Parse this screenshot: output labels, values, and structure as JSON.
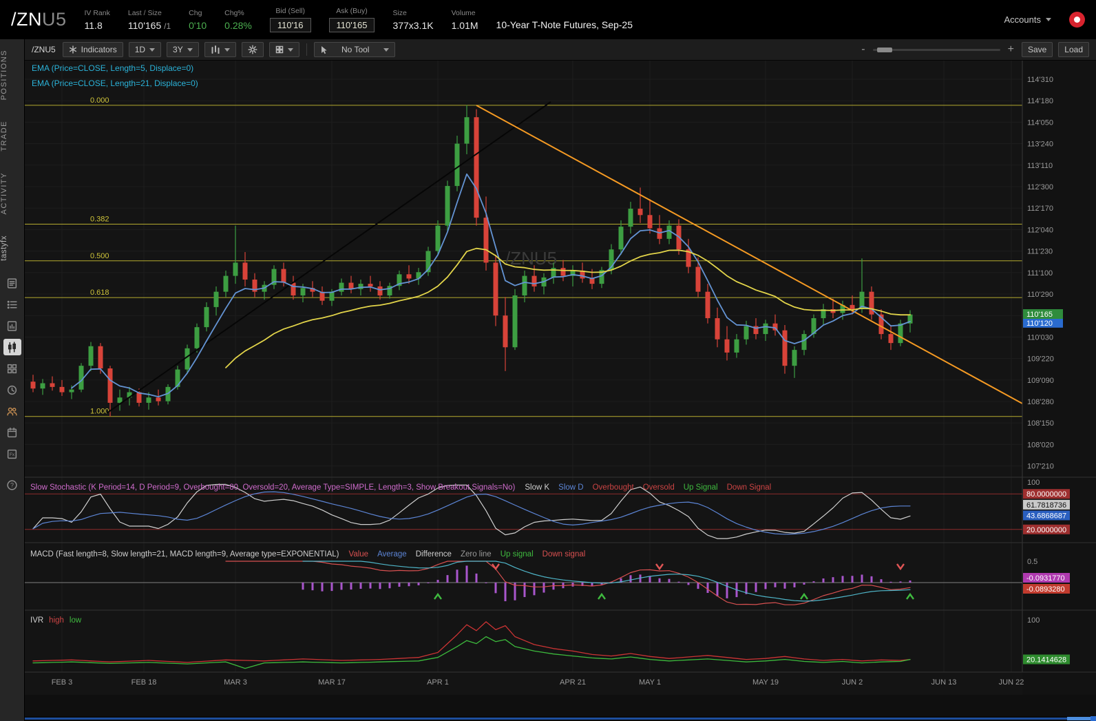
{
  "header": {
    "symbol_root": "/ZN",
    "symbol_suffix": "U5",
    "iv_rank_label": "IV Rank",
    "iv_rank_value": "11.8",
    "last_size_label": "Last / Size",
    "last_value": "110'165",
    "last_size_suffix": "/1",
    "chg_label": "Chg",
    "chg_value": "0'10",
    "chg_pct_label": "Chg%",
    "chg_pct_value": "0.28%",
    "bid_label": "Bid (Sell)",
    "bid_value": "110'16",
    "ask_label": "Ask (Buy)",
    "ask_value": "110'165",
    "size_label": "Size",
    "size_value": "377x3.1K",
    "volume_label": "Volume",
    "volume_value": "1.01M",
    "description": "10-Year T-Note Futures, Sep-25",
    "accounts_label": "Accounts",
    "up_color": "#4caf50"
  },
  "sidebar": {
    "tabs": [
      {
        "label": "POSITIONS"
      },
      {
        "label": "TRADE"
      },
      {
        "label": "ACTIVITY"
      },
      {
        "label": "tastyfx"
      }
    ],
    "icons": [
      "news-icon",
      "list-icon",
      "report-icon",
      "candle-chart-icon",
      "grid-watchlist-icon",
      "clock-icon",
      "people-icon",
      "calendar-icon",
      "functions-icon",
      "help-icon"
    ],
    "active_icon": "candle-chart-icon"
  },
  "toolbar": {
    "symbol": "/ZNU5",
    "indicators_label": "Indicators",
    "timeframe": "1D",
    "range": "3Y",
    "tool_label": "No Tool",
    "zoom_minus": "-",
    "zoom_plus": "+",
    "save_label": "Save",
    "load_label": "Load"
  },
  "chart": {
    "ema5_label": "EMA (Price=CLOSE, Length=5, Displace=0)",
    "ema21_label": "EMA (Price=CLOSE, Length=21, Displace=0)",
    "watermark": "/ZNU5",
    "ema5_color": "#6494d4",
    "ema21_color": "#e3d54a",
    "up_color": "#3d9e42",
    "down_color": "#d84339",
    "fib_color": "#b5ab2e",
    "trendline_color": "#f59a23"
  },
  "studies": {
    "stoch": {
      "title": "Slow Stochastic (K Period=14, D Period=9, Overbought=80, Oversold=20, Average Type=SIMPLE, Length=3, Show Breakout Signals=No)",
      "title_color": "#d06ccd",
      "legend": [
        {
          "text": "Slow K",
          "color": "#cfcfcf"
        },
        {
          "text": "Slow D",
          "color": "#5c85d6"
        },
        {
          "text": "Overbought",
          "color": "#cc4444"
        },
        {
          "text": "Oversold",
          "color": "#cc4444"
        },
        {
          "text": "Up Signal",
          "color": "#3fba3f"
        },
        {
          "text": "Down Signal",
          "color": "#cc4444"
        }
      ],
      "axis_top": "100",
      "tags": [
        {
          "text": "80.0000000",
          "value": 80,
          "bg": "#9e2f2f",
          "fg": "#fff"
        },
        {
          "text": "61.7818736",
          "value": 61.78,
          "bg": "#c9c9c9",
          "fg": "#111"
        },
        {
          "text": "43.6868687",
          "value": 43.69,
          "bg": "#2a5fc0",
          "fg": "#fff"
        },
        {
          "text": "20.0000000",
          "value": 20,
          "bg": "#9e2f2f",
          "fg": "#fff"
        }
      ]
    },
    "macd": {
      "title": "MACD (Fast length=8, Slow length=21, MACD length=9, Average type=EXPONENTIAL)",
      "title_color": "#cfcfcf",
      "legend": [
        {
          "text": "Value",
          "color": "#d85050"
        },
        {
          "text": "Average",
          "color": "#5c85d6"
        },
        {
          "text": "Difference",
          "color": "#cfcfcf"
        },
        {
          "text": "Zero line",
          "color": "#9a9a9a"
        },
        {
          "text": "Up signal",
          "color": "#3fba3f"
        },
        {
          "text": "Down signal",
          "color": "#d85050"
        }
      ],
      "axis_top": "0.5",
      "tags": [
        {
          "text": "-0.0931770",
          "bg": "#b03ab0",
          "fg": "#fff"
        },
        {
          "text": "-0.0893280",
          "bg": "#c23b2e",
          "fg": "#fff"
        }
      ]
    },
    "ivr": {
      "title": "IVR",
      "title_color": "#cfcfcf",
      "legend": [
        {
          "text": "high",
          "color": "#cc4444"
        },
        {
          "text": "low",
          "color": "#3fba3f"
        }
      ],
      "axis_top": "100",
      "tag": {
        "text": "20.1414628",
        "bg": "#2e8b2e",
        "fg": "#fff"
      }
    }
  },
  "chart_data": {
    "type": "candlestick",
    "symbol": "/ZNU5",
    "timeframe": "1D",
    "range": "3Y",
    "price_ticks": [
      {
        "t": "114'310",
        "i": 0
      },
      {
        "t": "114'180",
        "i": 1
      },
      {
        "t": "114'050",
        "i": 2
      },
      {
        "t": "113'240",
        "i": 3
      },
      {
        "t": "113'110",
        "i": 4
      },
      {
        "t": "112'300",
        "i": 5
      },
      {
        "t": "112'170",
        "i": 6
      },
      {
        "t": "112'040",
        "i": 7
      },
      {
        "t": "111'230",
        "i": 8
      },
      {
        "t": "111'100",
        "i": 9
      },
      {
        "t": "110'290",
        "i": 10
      },
      {
        "t": "110'030",
        "i": 12
      },
      {
        "t": "109'220",
        "i": 13
      },
      {
        "t": "109'090",
        "i": 14
      },
      {
        "t": "108'280",
        "i": 15
      },
      {
        "t": "108'150",
        "i": 16
      },
      {
        "t": "108'020",
        "i": 17
      },
      {
        "t": "107'210",
        "i": 18
      }
    ],
    "x_ticks": [
      {
        "t": "FEB 3",
        "i": 3
      },
      {
        "t": "FEB 18",
        "i": 11.5
      },
      {
        "t": "MAR 3",
        "i": 21
      },
      {
        "t": "MAR 17",
        "i": 31
      },
      {
        "t": "APR 1",
        "i": 42
      },
      {
        "t": "APR 21",
        "i": 56
      },
      {
        "t": "MAY 1",
        "i": 64
      },
      {
        "t": "MAY 19",
        "i": 76
      },
      {
        "t": "JUN 2",
        "i": 85
      },
      {
        "t": "JUN 13",
        "i": 94.5
      },
      {
        "t": "JUN 22",
        "i": 101.5
      }
    ],
    "fib_levels": [
      {
        "label": "0.000",
        "price": 114.476
      },
      {
        "label": "0.382",
        "price": 112.228
      },
      {
        "label": "0.500",
        "price": 111.534
      },
      {
        "label": "0.618",
        "price": 110.84
      },
      {
        "label": "1.000",
        "price": 108.592
      }
    ],
    "last_price_tag": {
      "label": "110'165",
      "price": 110.515625
    },
    "ema5_tag": {
      "label": "110'120",
      "price": 110.375
    },
    "candles": [
      [
        109.25,
        109.38,
        109.05,
        109.12
      ],
      [
        109.12,
        109.3,
        109.0,
        109.22
      ],
      [
        109.22,
        109.35,
        109.08,
        109.15
      ],
      [
        109.15,
        109.28,
        108.98,
        109.05
      ],
      [
        109.05,
        109.18,
        108.92,
        109.1
      ],
      [
        109.1,
        109.6,
        109.05,
        109.55
      ],
      [
        109.55,
        110.0,
        109.45,
        109.92
      ],
      [
        109.92,
        109.98,
        109.4,
        109.5
      ],
      [
        109.5,
        109.55,
        108.59,
        108.85
      ],
      [
        108.85,
        109.1,
        108.7,
        108.95
      ],
      [
        108.95,
        109.15,
        108.8,
        109.05
      ],
      [
        109.05,
        109.12,
        108.78,
        108.85
      ],
      [
        108.85,
        109.05,
        108.72,
        108.95
      ],
      [
        108.95,
        109.1,
        108.8,
        108.88
      ],
      [
        108.88,
        109.2,
        108.82,
        109.15
      ],
      [
        109.15,
        109.55,
        109.1,
        109.48
      ],
      [
        109.48,
        109.95,
        109.4,
        109.88
      ],
      [
        109.88,
        110.35,
        109.8,
        110.28
      ],
      [
        110.28,
        110.75,
        110.2,
        110.66
      ],
      [
        110.66,
        111.05,
        110.5,
        110.95
      ],
      [
        110.95,
        111.35,
        110.85,
        111.25
      ],
      [
        111.25,
        112.2,
        111.1,
        111.5
      ],
      [
        111.5,
        111.7,
        111.05,
        111.18
      ],
      [
        111.18,
        111.3,
        110.85,
        110.95
      ],
      [
        110.95,
        111.15,
        110.8,
        111.08
      ],
      [
        111.08,
        111.45,
        111.0,
        111.38
      ],
      [
        111.38,
        111.5,
        111.05,
        111.12
      ],
      [
        111.12,
        111.25,
        110.8,
        110.88
      ],
      [
        110.88,
        111.1,
        110.75,
        111.02
      ],
      [
        111.02,
        111.15,
        110.85,
        110.95
      ],
      [
        110.95,
        111.05,
        110.7,
        110.78
      ],
      [
        110.78,
        111.0,
        110.68,
        110.95
      ],
      [
        110.95,
        111.2,
        110.88,
        111.12
      ],
      [
        111.12,
        111.25,
        110.92,
        111.0
      ],
      [
        111.0,
        111.18,
        110.88,
        111.1
      ],
      [
        111.1,
        111.25,
        110.95,
        111.05
      ],
      [
        111.05,
        111.15,
        110.8,
        110.88
      ],
      [
        110.88,
        111.12,
        110.82,
        111.06
      ],
      [
        111.06,
        111.35,
        110.98,
        111.28
      ],
      [
        111.28,
        111.45,
        111.1,
        111.2
      ],
      [
        111.2,
        111.4,
        111.08,
        111.32
      ],
      [
        111.32,
        111.8,
        111.25,
        111.72
      ],
      [
        111.72,
        112.3,
        111.65,
        112.2
      ],
      [
        112.2,
        113.05,
        112.1,
        112.95
      ],
      [
        112.95,
        113.9,
        112.85,
        113.75
      ],
      [
        113.75,
        114.48,
        113.55,
        114.25
      ],
      [
        114.25,
        114.4,
        112.2,
        112.35
      ],
      [
        112.35,
        112.75,
        111.35,
        111.5
      ],
      [
        111.5,
        111.65,
        110.3,
        110.5
      ],
      [
        110.5,
        110.85,
        109.45,
        109.9
      ],
      [
        109.9,
        111.0,
        109.85,
        110.88
      ],
      [
        110.88,
        111.35,
        110.75,
        111.25
      ],
      [
        111.25,
        111.45,
        110.95,
        111.05
      ],
      [
        111.05,
        111.3,
        110.9,
        111.22
      ],
      [
        111.22,
        111.5,
        111.1,
        111.4
      ],
      [
        111.4,
        111.55,
        111.15,
        111.25
      ],
      [
        111.25,
        111.45,
        111.05,
        111.35
      ],
      [
        111.35,
        111.5,
        111.12,
        111.2
      ],
      [
        111.2,
        111.38,
        111.0,
        111.1
      ],
      [
        111.1,
        111.42,
        111.02,
        111.36
      ],
      [
        111.36,
        111.85,
        111.28,
        111.75
      ],
      [
        111.75,
        112.3,
        111.65,
        112.18
      ],
      [
        112.18,
        112.65,
        112.05,
        112.52
      ],
      [
        112.52,
        112.92,
        112.25,
        112.4
      ],
      [
        112.4,
        112.7,
        112.05,
        112.15
      ],
      [
        112.15,
        112.4,
        111.85,
        111.95
      ],
      [
        111.95,
        112.3,
        111.85,
        112.2
      ],
      [
        112.2,
        112.32,
        111.65,
        111.75
      ],
      [
        111.75,
        111.95,
        111.3,
        111.42
      ],
      [
        111.42,
        111.6,
        110.85,
        110.95
      ],
      [
        110.95,
        111.1,
        110.35,
        110.45
      ],
      [
        110.45,
        110.65,
        109.9,
        110.05
      ],
      [
        110.05,
        110.3,
        109.65,
        109.8
      ],
      [
        109.8,
        110.15,
        109.7,
        110.05
      ],
      [
        110.05,
        110.4,
        109.95,
        110.3
      ],
      [
        110.3,
        110.45,
        110.05,
        110.15
      ],
      [
        110.15,
        110.42,
        110.02,
        110.35
      ],
      [
        110.35,
        110.52,
        110.12,
        110.22
      ],
      [
        110.22,
        110.32,
        109.4,
        109.55
      ],
      [
        109.55,
        109.92,
        109.32,
        109.85
      ],
      [
        109.85,
        110.22,
        109.75,
        110.15
      ],
      [
        110.15,
        110.52,
        110.08,
        110.45
      ],
      [
        110.45,
        110.72,
        110.32,
        110.62
      ],
      [
        110.62,
        110.82,
        110.45,
        110.55
      ],
      [
        110.55,
        110.78,
        110.42,
        110.7
      ],
      [
        110.7,
        110.88,
        110.52,
        110.62
      ],
      [
        110.62,
        111.58,
        110.55,
        110.95
      ],
      [
        110.95,
        111.05,
        110.42,
        110.52
      ],
      [
        110.52,
        110.62,
        110.05,
        110.15
      ],
      [
        110.15,
        110.32,
        109.85,
        109.98
      ],
      [
        109.98,
        110.42,
        109.92,
        110.35
      ],
      [
        110.35,
        110.6,
        110.18,
        110.52
      ]
    ],
    "signals": {
      "macd_up": [
        42,
        59,
        80,
        91
      ],
      "macd_down": [
        48,
        65,
        90
      ]
    },
    "ivr_high": [
      [
        0,
        17
      ],
      [
        4,
        19
      ],
      [
        8,
        15
      ],
      [
        12,
        18
      ],
      [
        16,
        14
      ],
      [
        20,
        19
      ],
      [
        24,
        17
      ],
      [
        28,
        21
      ],
      [
        32,
        18
      ],
      [
        36,
        20
      ],
      [
        40,
        24
      ],
      [
        42,
        34
      ],
      [
        44,
        70
      ],
      [
        45,
        90
      ],
      [
        46,
        78
      ],
      [
        47,
        96
      ],
      [
        48,
        80
      ],
      [
        49,
        88
      ],
      [
        50,
        66
      ],
      [
        52,
        50
      ],
      [
        54,
        42
      ],
      [
        56,
        37
      ],
      [
        58,
        30
      ],
      [
        60,
        27
      ],
      [
        62,
        32
      ],
      [
        64,
        26
      ],
      [
        66,
        22
      ],
      [
        68,
        25
      ],
      [
        70,
        28
      ],
      [
        72,
        24
      ],
      [
        74,
        20
      ],
      [
        76,
        22
      ],
      [
        78,
        26
      ],
      [
        80,
        21
      ],
      [
        82,
        18
      ],
      [
        84,
        20
      ],
      [
        86,
        17
      ],
      [
        88,
        19
      ],
      [
        90,
        18
      ],
      [
        91,
        20
      ]
    ],
    "ivr_low": [
      [
        0,
        13
      ],
      [
        4,
        15
      ],
      [
        8,
        12
      ],
      [
        12,
        14
      ],
      [
        16,
        11
      ],
      [
        20,
        15
      ],
      [
        22,
        2
      ],
      [
        24,
        13
      ],
      [
        28,
        15
      ],
      [
        32,
        13
      ],
      [
        36,
        15
      ],
      [
        40,
        17
      ],
      [
        42,
        24
      ],
      [
        44,
        46
      ],
      [
        45,
        58
      ],
      [
        46,
        52
      ],
      [
        47,
        66
      ],
      [
        48,
        56
      ],
      [
        49,
        60
      ],
      [
        50,
        46
      ],
      [
        52,
        37
      ],
      [
        54,
        31
      ],
      [
        56,
        27
      ],
      [
        58,
        23
      ],
      [
        60,
        21
      ],
      [
        62,
        25
      ],
      [
        64,
        20
      ],
      [
        66,
        17
      ],
      [
        68,
        19
      ],
      [
        70,
        21
      ],
      [
        72,
        18
      ],
      [
        74,
        15
      ],
      [
        76,
        17
      ],
      [
        78,
        20
      ],
      [
        80,
        16
      ],
      [
        82,
        14
      ],
      [
        84,
        16
      ],
      [
        86,
        13
      ],
      [
        88,
        15
      ],
      [
        90,
        16
      ],
      [
        91,
        20
      ]
    ]
  }
}
